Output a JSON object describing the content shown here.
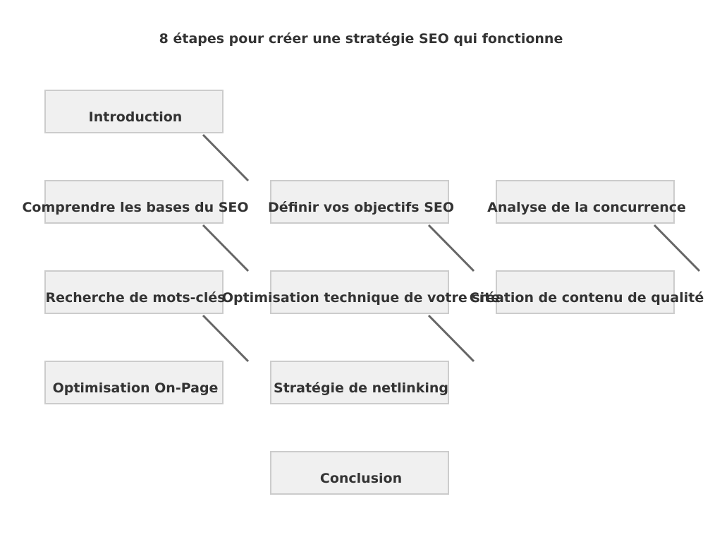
{
  "title": "8 étapes pour créer une stratégie SEO qui fonctionne",
  "colors": {
    "node_fill": "#f0f0f0",
    "node_border": "#cccccc",
    "edge": "#666666",
    "text": "#333333"
  },
  "nodes": [
    {
      "id": "introduction",
      "label": "Introduction"
    },
    {
      "id": "bases",
      "label": "Comprendre les bases du SEO"
    },
    {
      "id": "objectifs",
      "label": "Définir vos objectifs SEO"
    },
    {
      "id": "concurrence",
      "label": "Analyse de la concurrence"
    },
    {
      "id": "mots-cles",
      "label": "Recherche de mots-clés"
    },
    {
      "id": "technique",
      "label": "Optimisation technique de votre site"
    },
    {
      "id": "contenu",
      "label": "Création de contenu de qualité"
    },
    {
      "id": "on-page",
      "label": "Optimisation On-Page"
    },
    {
      "id": "netlinking",
      "label": "Stratégie de netlinking"
    },
    {
      "id": "conclusion",
      "label": "Conclusion"
    }
  ],
  "edges": [
    {
      "from": "introduction",
      "to": "objectifs"
    },
    {
      "from": "bases",
      "to": "technique"
    },
    {
      "from": "objectifs",
      "to": "contenu"
    },
    {
      "from": "concurrence",
      "to": "contenu"
    },
    {
      "from": "mots-cles",
      "to": "netlinking"
    },
    {
      "from": "technique",
      "to": "netlinking"
    }
  ]
}
